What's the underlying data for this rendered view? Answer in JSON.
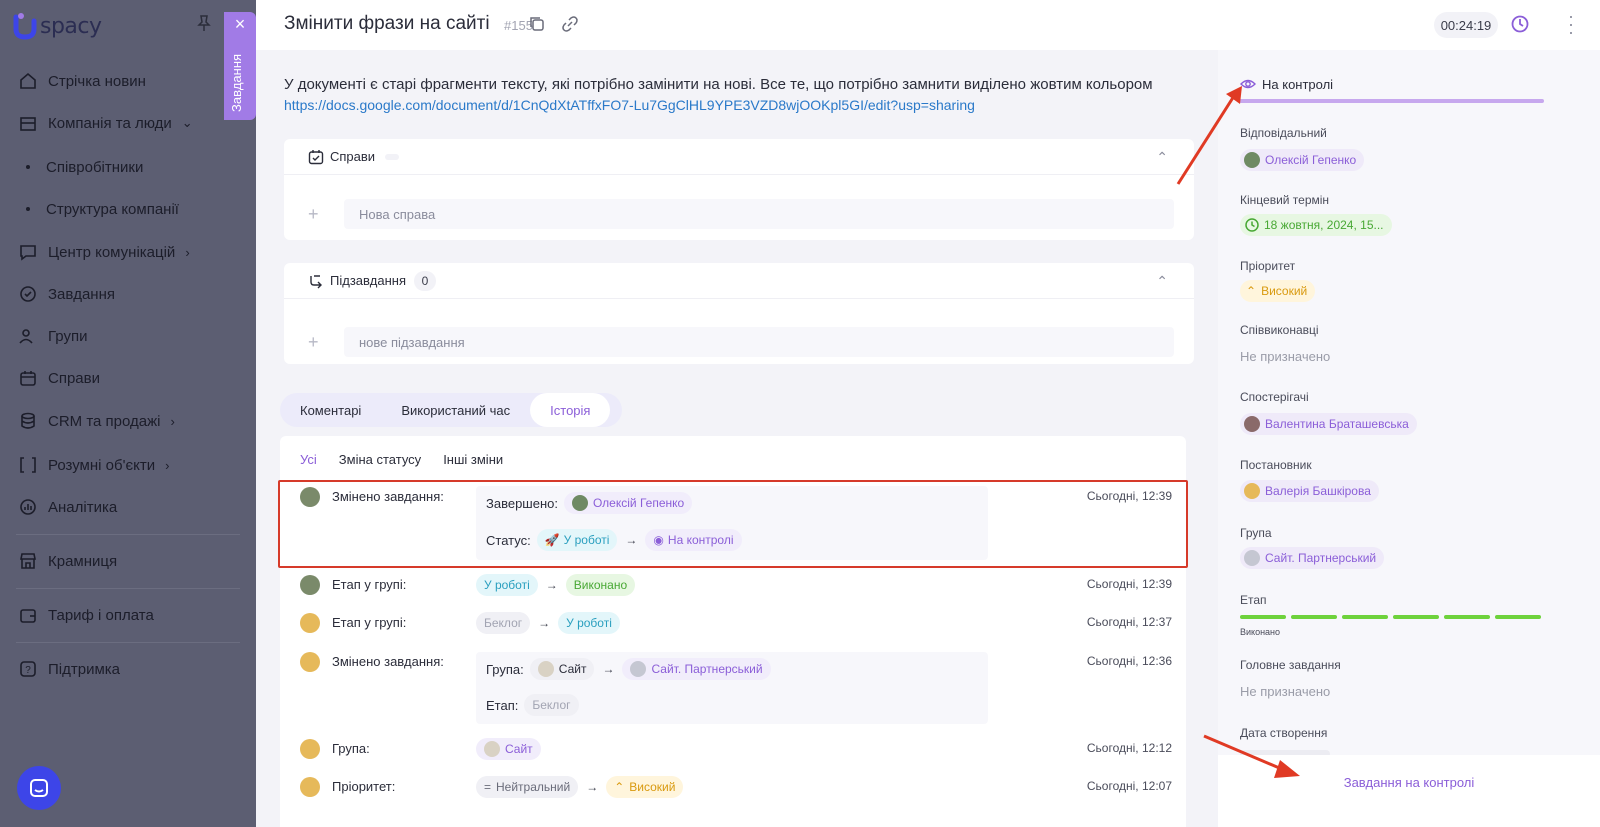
{
  "sidebar": {
    "logo_text": "spacy",
    "items": [
      {
        "label": "Стрічка новин"
      },
      {
        "label": "Компанія та люди"
      },
      {
        "label": "Співробітники"
      },
      {
        "label": "Структура компанії"
      },
      {
        "label": "Центр комунікацій"
      },
      {
        "label": "Завдання"
      },
      {
        "label": "Групи"
      },
      {
        "label": "Справи"
      },
      {
        "label": "CRM та продажі"
      },
      {
        "label": "Розумні об'єкти"
      },
      {
        "label": "Аналітика"
      },
      {
        "label": "Крамниця"
      },
      {
        "label": "Тариф і оплата"
      },
      {
        "label": "Підтримка"
      }
    ],
    "side_tab_label": "Завдання"
  },
  "header": {
    "title": "Змінити фрази на сайті",
    "task_number": "#155",
    "timer": "00:24:19"
  },
  "main": {
    "description": "У документі є старі фрагменти тексту, які потрібно замінити на нові. Все те, що потрібно замнити виділено жовтим кольором",
    "link": "https://docs.google.com/document/d/1CnQdXtATffxFO7-Lu7GgClHL9YPE3VZD8wjOOKpl5GI/edit?usp=sharing",
    "deals": {
      "title": "Справи",
      "placeholder": "Нова справа"
    },
    "subtasks": {
      "title": "Підзавдання",
      "count": "0",
      "placeholder": "нове підзавдання"
    },
    "tabs": [
      {
        "label": "Коментарі"
      },
      {
        "label": "Використаний час"
      },
      {
        "label": "Історія"
      }
    ],
    "filters": [
      {
        "label": "Усі"
      },
      {
        "label": "Зміна статусу"
      },
      {
        "label": "Інші зміни"
      }
    ],
    "history": {
      "r1": {
        "label": "Змінено завдання:",
        "time": "Сьогодні, 12:39",
        "k1": "Завершено:",
        "user": "Олексій Гепенко",
        "k2": "Статус:",
        "from": "У роботі",
        "to": "На контролі"
      },
      "r2": {
        "label": "Етап у групі:",
        "time": "Сьогодні, 12:39",
        "from": "У роботі",
        "to": "Виконано"
      },
      "r3": {
        "label": "Етап у групі:",
        "time": "Сьогодні, 12:37",
        "from": "Беклог",
        "to": "У роботі"
      },
      "r4": {
        "label": "Змінено завдання:",
        "time": "Сьогодні, 12:36",
        "k1": "Група:",
        "from": "Сайт",
        "to": "Сайт. Партнерський",
        "k2": "Етап:",
        "stage": "Беклог"
      },
      "r5": {
        "label": "Група:",
        "time": "Сьогодні, 12:12",
        "value": "Сайт"
      },
      "r6": {
        "label": "Пріоритет:",
        "time": "Сьогодні, 12:07",
        "from": "Нейтральний",
        "to": "Високий"
      }
    }
  },
  "panel": {
    "status": "На контролі",
    "responsible_label": "Відповідальний",
    "responsible": "Олексій Гепенко",
    "deadline_label": "Кінцевий термін",
    "deadline": "18 жовтня, 2024, 15...",
    "priority_label": "Пріоритет",
    "priority": "Високий",
    "coexec_label": "Співвиконавці",
    "coexec": "Не призначено",
    "observers_label": "Спостерігачі",
    "observer": "Валентина Браташевська",
    "creator_label": "Постановник",
    "creator": "Валерія Башкірова",
    "group_label": "Група",
    "group": "Сайт. Партнерський",
    "stage_label": "Етап",
    "stage": "Виконано",
    "parent_label": "Головне завдання",
    "parent": "Не призначено",
    "created_label": "Дата створення",
    "bottom_button": "Завдання на контролі"
  },
  "colors": {
    "accent": "#8b5ed8",
    "sidebar": "#5c5e72",
    "highlight_red": "#d63a2a",
    "stage_green": "#6ed23c"
  }
}
